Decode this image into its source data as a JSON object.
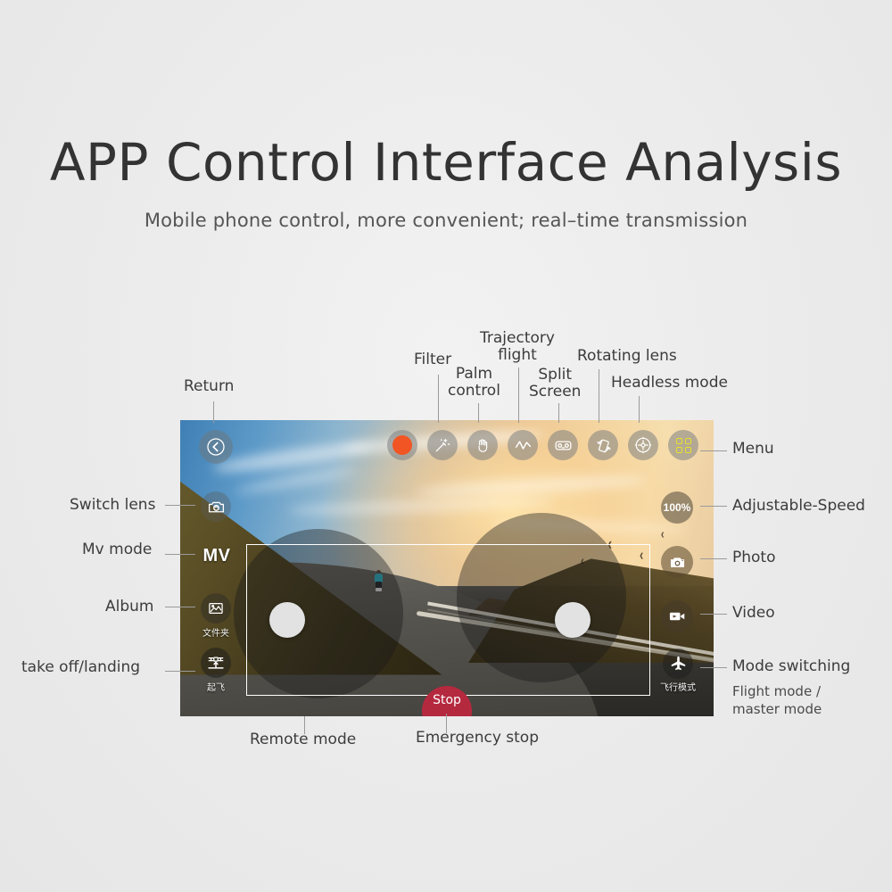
{
  "header": {
    "title": "APP Control Interface Analysis",
    "subtitle": "Mobile phone control, more convenient; real–time transmission"
  },
  "device": {
    "toolbar": [
      {
        "name": "record-button",
        "icon": "record-dot",
        "label": ""
      },
      {
        "name": "filter-button",
        "icon": "magic-wand-icon",
        "label": "Filter"
      },
      {
        "name": "palm-control-button",
        "icon": "palm-hand-icon",
        "label": "Palm control"
      },
      {
        "name": "trajectory-button",
        "icon": "waveform-icon",
        "label": "Trajectory flight"
      },
      {
        "name": "split-screen-button",
        "icon": "vr-goggles-icon",
        "label": "Split Screen"
      },
      {
        "name": "rotating-lens-button",
        "icon": "rotate-phone-icon",
        "label": "Rotating lens"
      },
      {
        "name": "headless-mode-button",
        "icon": "compass-icon",
        "label": "Headless mode"
      },
      {
        "name": "menu-button",
        "icon": "grid-menu-icon",
        "label": "Menu"
      }
    ],
    "left_rail": {
      "back": "",
      "mv": "MV",
      "album_label": "文件夹",
      "takeoff_label": "起飞"
    },
    "right_rail": {
      "speed": "100%",
      "flight_mode_label": "飞行模式"
    },
    "stop_button": "Stop"
  },
  "callouts": {
    "return": "Return",
    "filter": "Filter",
    "palm_control": "Palm\ncontrol",
    "trajectory_flight": "Trajectory\nflight",
    "split_screen": "Split\nScreen",
    "rotating_lens": "Rotating lens",
    "headless_mode": "Headless mode",
    "switch_lens": "Switch lens",
    "mv_mode": "Mv mode",
    "album": "Album",
    "take_off_landing": "take off/landing",
    "menu": "Menu",
    "adjustable_speed": "Adjustable-Speed",
    "photo": "Photo",
    "video": "Video",
    "mode_switching": "Mode switching",
    "mode_switching_sub": "Flight mode /\nmaster mode",
    "remote_mode": "Remote mode",
    "emergency_stop": "Emergency stop"
  },
  "colors": {
    "background": "#ececec",
    "title": "#333333",
    "record_orange": "#f05523",
    "menu_yellow": "#e8e02a",
    "stop_red": "#b5293f",
    "leader_line": "#9a9a9a"
  }
}
